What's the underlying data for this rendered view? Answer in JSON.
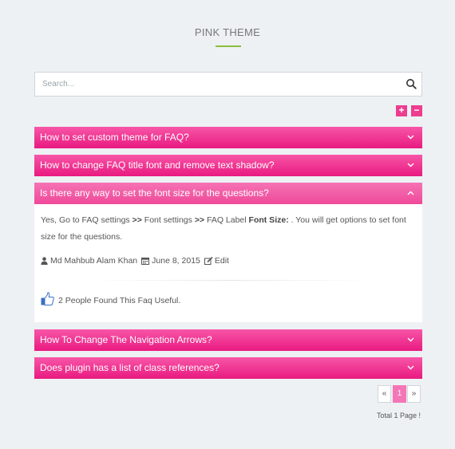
{
  "header": {
    "title": "PINK THEME"
  },
  "search": {
    "placeholder": "Search..."
  },
  "controls": {
    "expand_label": "+",
    "collapse_label": "−"
  },
  "faqs": [
    {
      "question": "How to set custom theme for FAQ?",
      "open": false
    },
    {
      "question": "How to change FAQ title font and remove text shadow?",
      "open": false
    },
    {
      "question": "Is there any way to set the font size for the questions?",
      "open": true
    },
    {
      "question": "How To Change The Navigation Arrows?",
      "open": false
    },
    {
      "question": "Does plugin has a list of class references?",
      "open": false
    }
  ],
  "answer": {
    "part1": "Yes, Go to FAQ settings ",
    "sep1": ">>",
    "part2": " Font settings ",
    "sep2": ">>",
    "part3": " FAQ Label ",
    "bold": "Font Size:",
    "part4": " . You will get options to set font size for the questions.",
    "author": "Md Mahbub Alam Khan",
    "date": "June 8, 2015",
    "edit_label": "Edit",
    "useful_text": "2 People Found This Faq Useful."
  },
  "pagination": {
    "prev_label": "«",
    "current_page": "1",
    "next_label": "»",
    "total_text": "Total 1 Page !"
  },
  "colors": {
    "accent": "#ec3d8f",
    "title_line": "#8bbf3c",
    "background": "#edf1f4"
  }
}
